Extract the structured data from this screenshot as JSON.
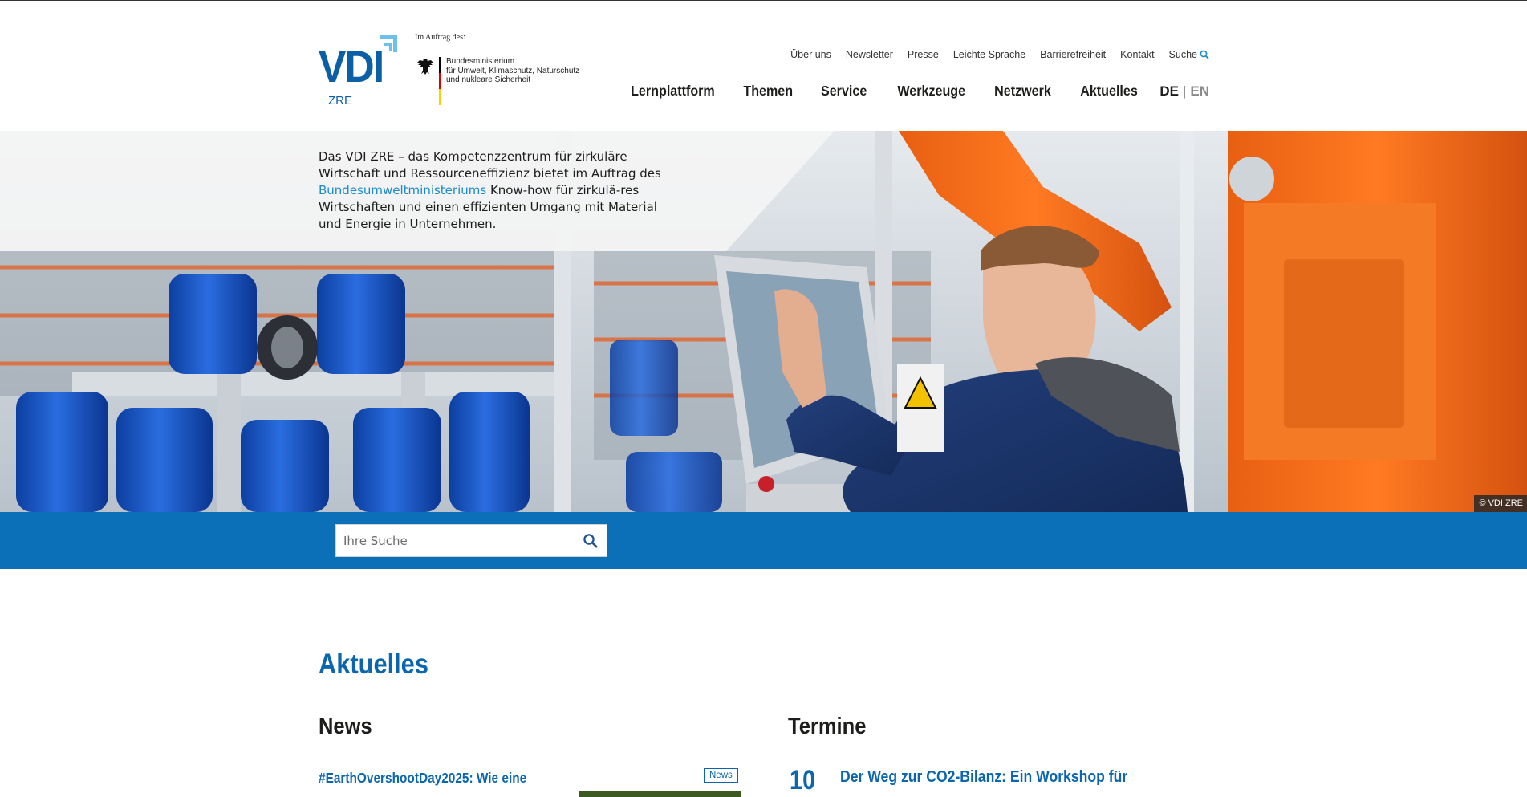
{
  "branding": {
    "vdi_logo_text": "VDI",
    "vdi_logo_subtext": "ZRE",
    "auftrag_label": "Im Auftrag des:",
    "ministry_lines": [
      "Bundesministerium",
      "für Umwelt, Klimaschutz, Naturschutz",
      "und nukleare Sicherheit"
    ]
  },
  "meta_nav": {
    "items": [
      "Über uns",
      "Newsletter",
      "Presse",
      "Leichte Sprache",
      "Barrierefreiheit",
      "Kontakt"
    ],
    "search_label": "Suche"
  },
  "main_nav": {
    "items": [
      "Lernplattform",
      "Themen",
      "Service",
      "Werkzeuge",
      "Netzwerk",
      "Aktuelles"
    ],
    "lang_active": "DE",
    "lang_separator": "|",
    "lang_other": "EN"
  },
  "hero": {
    "intro_before": "Das VDI ZRE – das Kompetenzzentrum für zirkuläre Wirtschaft und Ressourceneffizienz bietet im Auftrag des ",
    "intro_link": "Bundesumweltministeriums",
    "intro_after": " Know-how für zirkulä-res Wirtschaften und einen effizienten Umgang mit Material und Energie in Unternehmen.",
    "copyright": "© VDI ZRE"
  },
  "search": {
    "placeholder": "Ihre Suche"
  },
  "content": {
    "section_title": "Aktuelles",
    "news_heading": "News",
    "termine_heading": "Termine",
    "news_item_title": "#EarthOvershootDay2025: Wie eine",
    "news_item_badge": "News",
    "event_day": "10",
    "event_title": "Der Weg zur CO2-Bilanz: Ein Workshop für"
  },
  "colors": {
    "brand_blue": "#0b66ad",
    "band_blue": "#0b70b8",
    "link_blue": "#1d8ac8",
    "logo_accent": "#6cc0ea"
  }
}
